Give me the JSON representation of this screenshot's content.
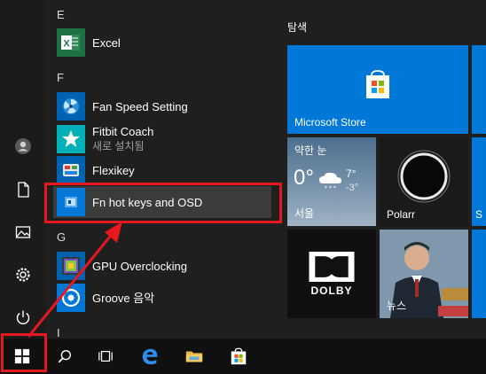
{
  "app_list": {
    "group_e": "E",
    "excel": "Excel",
    "group_f": "F",
    "fan_speed": "Fan Speed Setting",
    "fitbit": "Fitbit Coach",
    "fitbit_sub": "새로 설치됨",
    "flexikey": "Flexikey",
    "fn_hotkeys": "Fn hot keys and OSD",
    "group_g": "G",
    "gpu_oc": "GPU Overclocking",
    "groove": "Groove 음악",
    "group_i": "I"
  },
  "tiles": {
    "group_label": "탐색",
    "store": "Microsoft Store",
    "weather_cond": "약한 눈",
    "weather_temp": "0°",
    "weather_hi": "7°",
    "weather_lo": "-3°",
    "weather_city": "서울",
    "polarr": "Polarr",
    "dolby": "DOLBY",
    "news": "뉴스",
    "partial_s": "S"
  },
  "colors": {
    "accent": "#0078d7",
    "highlight_red": "#e5171f",
    "excel_green": "#1e7145"
  }
}
